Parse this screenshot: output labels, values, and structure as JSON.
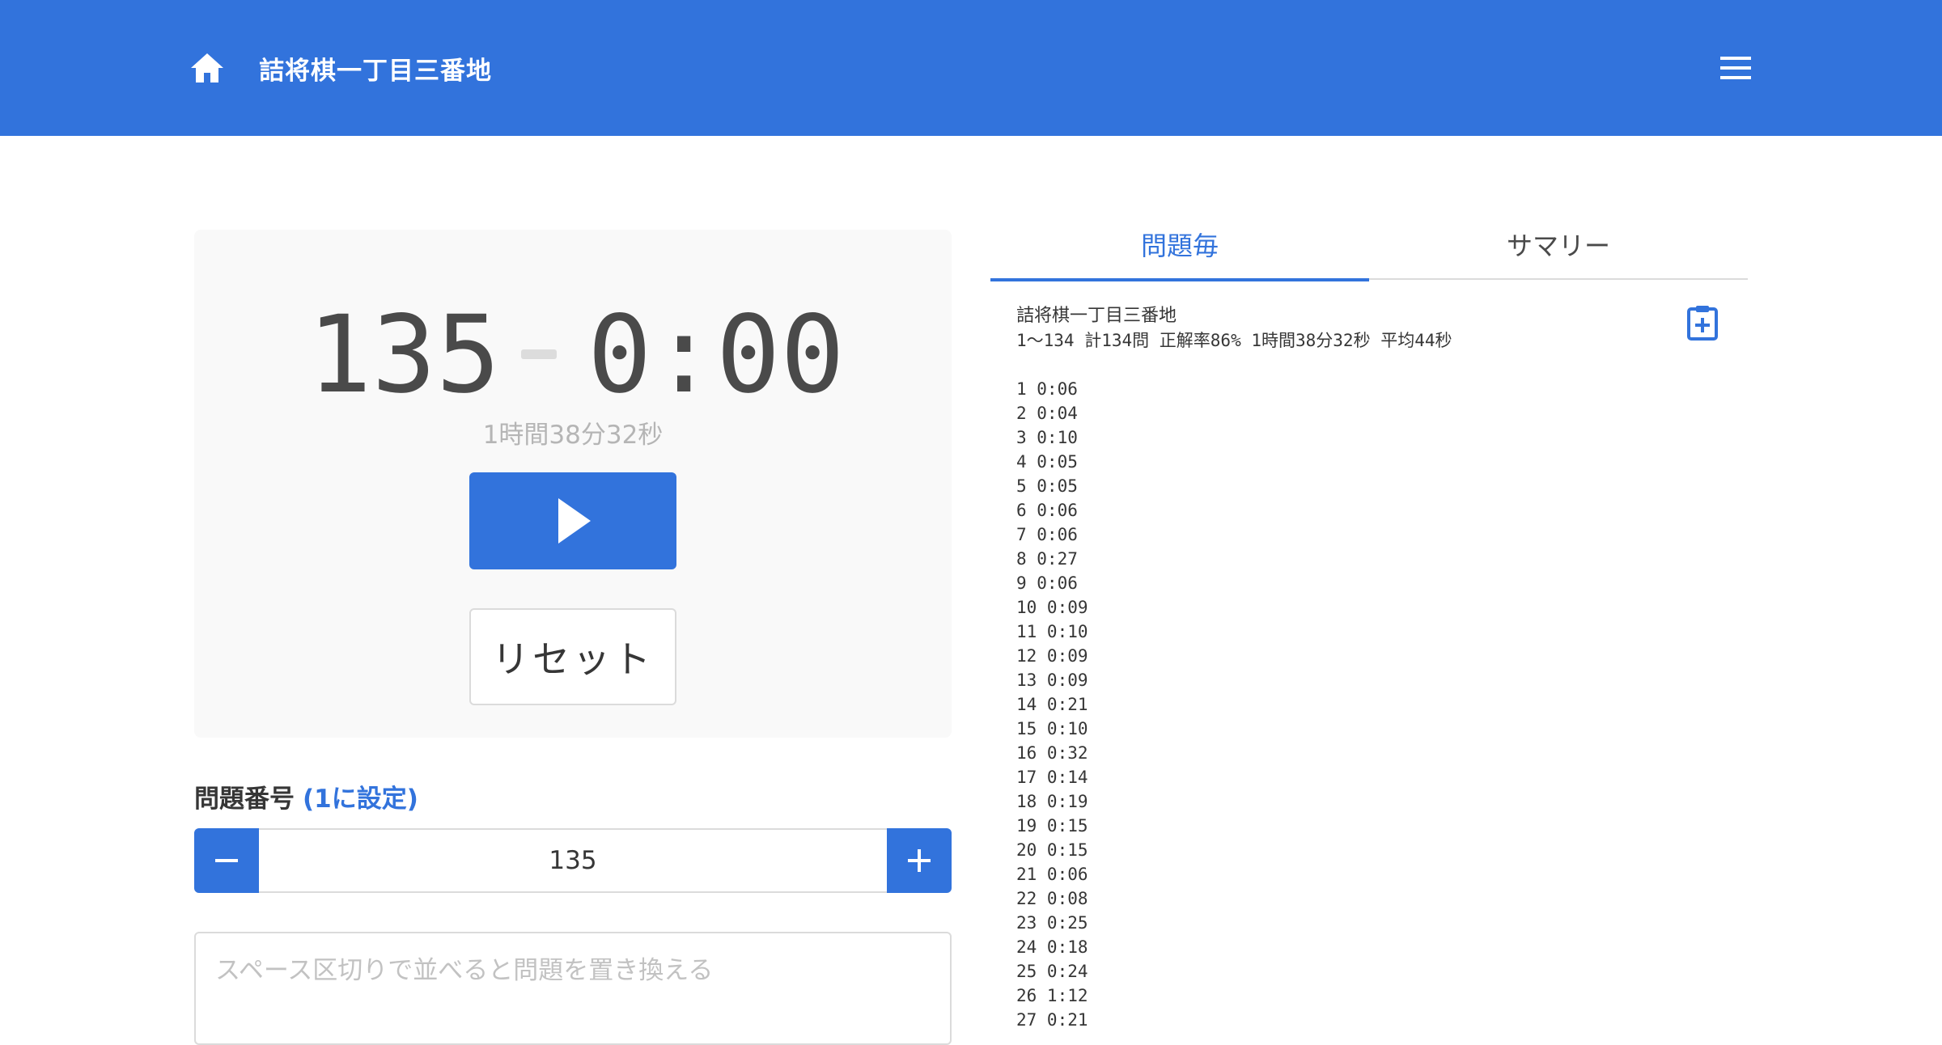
{
  "navbar": {
    "brand": "詰将棋一丁目三番地"
  },
  "timer": {
    "count": "135",
    "time": "0:00",
    "total": "1時間38分32秒",
    "reset_label": "リセット"
  },
  "problem": {
    "label": "問題番号",
    "set_link": "(1に設定)",
    "value": "135"
  },
  "replace": {
    "placeholder": "スペース区切りで並べると問題を置き換える"
  },
  "tabs": {
    "per_problem": "問題毎",
    "summary": "サマリー"
  },
  "log": {
    "title": "詰将棋一丁目三番地",
    "summary": "1〜134 計134問 正解率86% 1時間38分32秒 平均44秒",
    "entries": [
      "1 0:06",
      "2 0:04",
      "3 0:10",
      "4 0:05",
      "5 0:05",
      "6 0:06",
      "7 0:06",
      "8 0:27",
      "9 0:06",
      "10 0:09",
      "11 0:10",
      "12 0:09",
      "13 0:09",
      "14 0:21",
      "15 0:10",
      "16 0:32",
      "17 0:14",
      "18 0:19",
      "19 0:15",
      "20 0:15",
      "21 0:06",
      "22 0:08",
      "23 0:25",
      "24 0:18",
      "25 0:24",
      "26 1:12",
      "27 0:21"
    ]
  },
  "colors": {
    "primary": "#3273dc",
    "text": "#363636",
    "muted": "#b5b5b5"
  }
}
